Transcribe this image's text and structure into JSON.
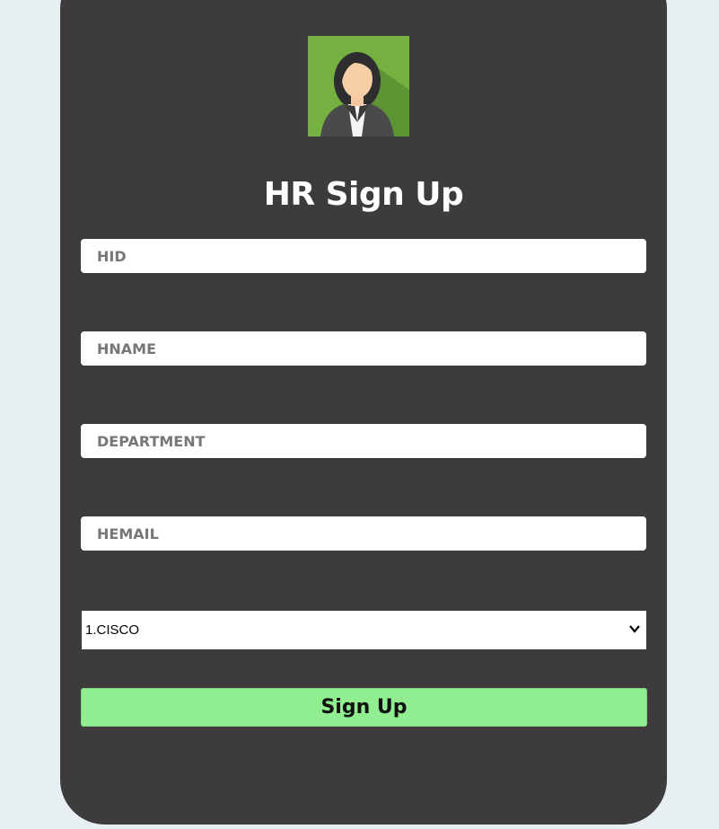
{
  "form": {
    "title": "HR Sign Up",
    "fields": [
      {
        "name": "hid",
        "placeholder": "HID",
        "value": ""
      },
      {
        "name": "hname",
        "placeholder": "HNAME",
        "value": ""
      },
      {
        "name": "department",
        "placeholder": "DEPARTMENT",
        "value": ""
      },
      {
        "name": "hemail",
        "placeholder": "HEMAIL",
        "value": ""
      }
    ],
    "company_select": {
      "selected": "1.CISCO",
      "options": [
        "1.CISCO"
      ]
    },
    "submit_label": "Sign Up"
  },
  "avatar": {
    "icon": "female-user-avatar-icon"
  },
  "colors": {
    "page_background": "#e8eff2",
    "card_background": "#3d3b3c",
    "button_background": "#90ee90",
    "avatar_background": "#76b041"
  }
}
